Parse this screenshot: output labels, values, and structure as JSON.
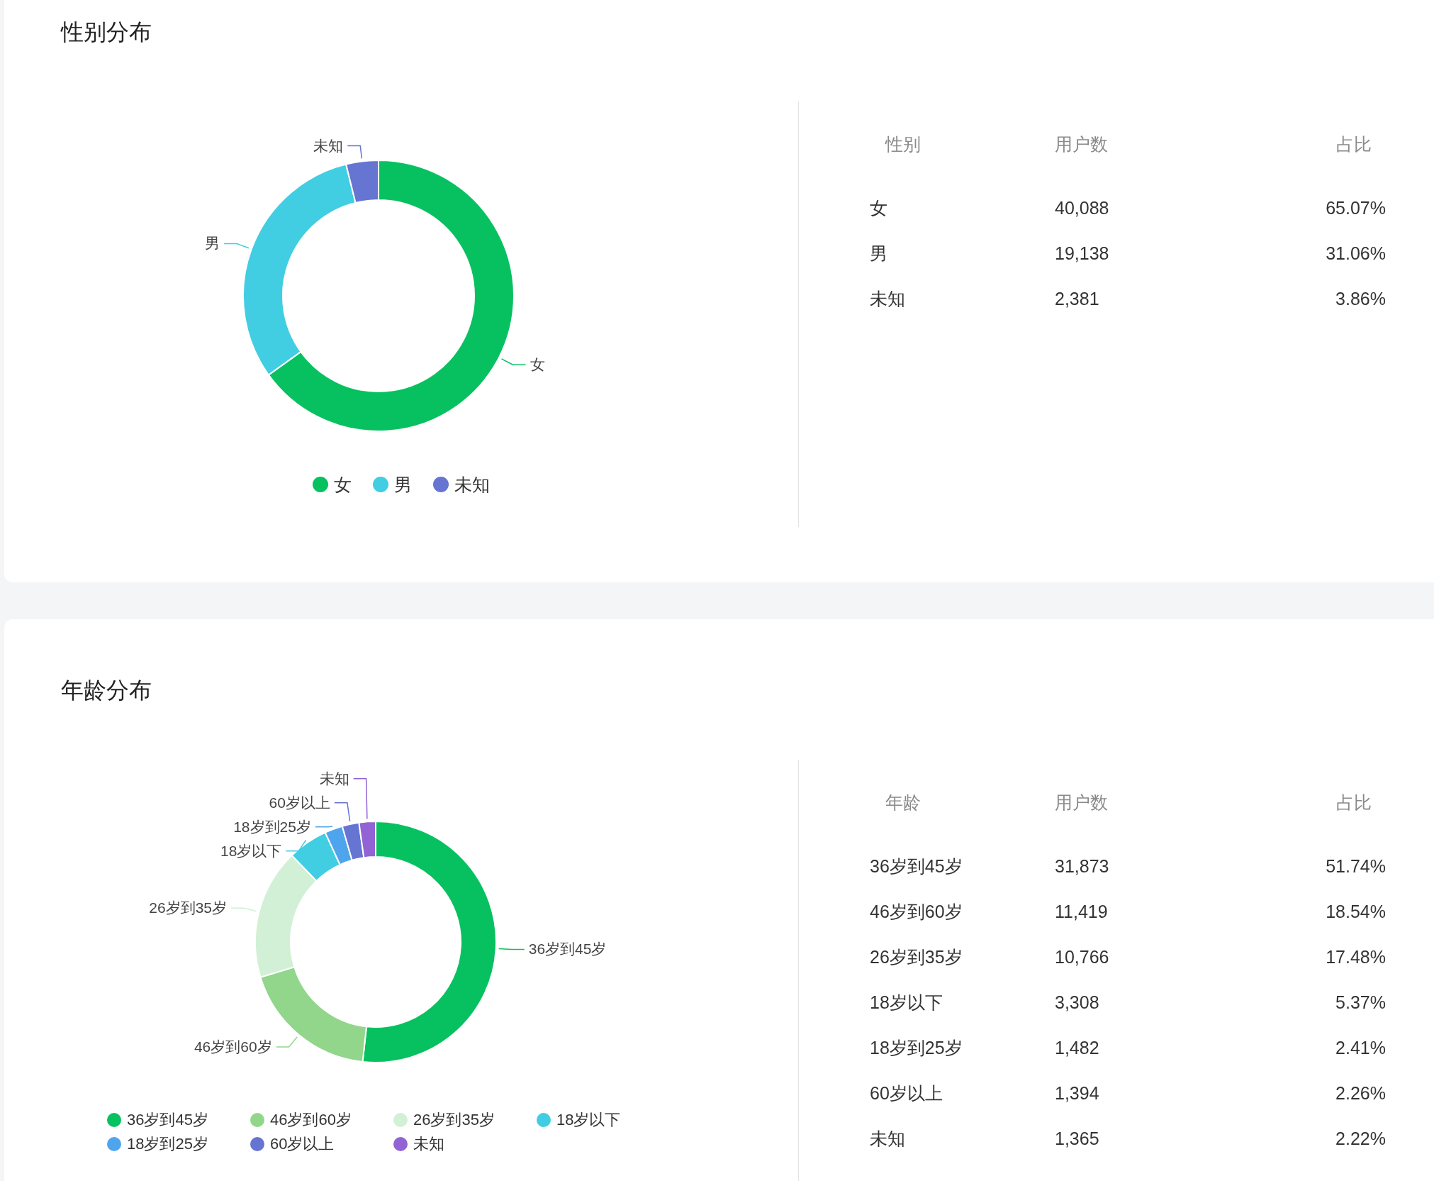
{
  "sections": [
    {
      "title": "性别分布",
      "chart_data": {
        "type": "donut",
        "categories": [
          "女",
          "男",
          "未知"
        ],
        "values": [
          65.07,
          31.06,
          3.86
        ]
      },
      "legend": [
        {
          "label": "女",
          "color": "#07c160"
        },
        {
          "label": "男",
          "color": "#41cde2"
        },
        {
          "label": "未知",
          "color": "#6674d2"
        }
      ],
      "table": {
        "columns": [
          "性别",
          "用户数",
          "占比"
        ],
        "rows": [
          [
            "女",
            "40,088",
            "65.07%"
          ],
          [
            "男",
            "19,138",
            "31.06%"
          ],
          [
            "未知",
            "2,381",
            "3.86%"
          ]
        ]
      }
    },
    {
      "title": "年龄分布",
      "chart_data": {
        "type": "donut",
        "categories": [
          "36岁到45岁",
          "46岁到60岁",
          "26岁到35岁",
          "18岁以下",
          "18岁到25岁",
          "60岁以上",
          "未知"
        ],
        "values": [
          51.74,
          18.54,
          17.48,
          5.37,
          2.41,
          2.26,
          2.22
        ]
      },
      "legend": [
        {
          "label": "36岁到45岁",
          "color": "#07c160"
        },
        {
          "label": "46岁到60岁",
          "color": "#91d68b"
        },
        {
          "label": "26岁到35岁",
          "color": "#d1f0d5"
        },
        {
          "label": "18岁以下",
          "color": "#41cde2"
        },
        {
          "label": "18岁到25岁",
          "color": "#4fa5ed"
        },
        {
          "label": "60岁以上",
          "color": "#6674d2"
        },
        {
          "label": "未知",
          "color": "#9163d4"
        }
      ],
      "table": {
        "columns": [
          "年龄",
          "用户数",
          "占比"
        ],
        "rows": [
          [
            "36岁到45岁",
            "31,873",
            "51.74%"
          ],
          [
            "46岁到60岁",
            "11,419",
            "18.54%"
          ],
          [
            "26岁到35岁",
            "10,766",
            "17.48%"
          ],
          [
            "18岁以下",
            "3,308",
            "5.37%"
          ],
          [
            "18岁到25岁",
            "1,482",
            "2.41%"
          ],
          [
            "60岁以上",
            "1,394",
            "2.26%"
          ],
          [
            "未知",
            "1,365",
            "2.22%"
          ]
        ]
      }
    }
  ]
}
